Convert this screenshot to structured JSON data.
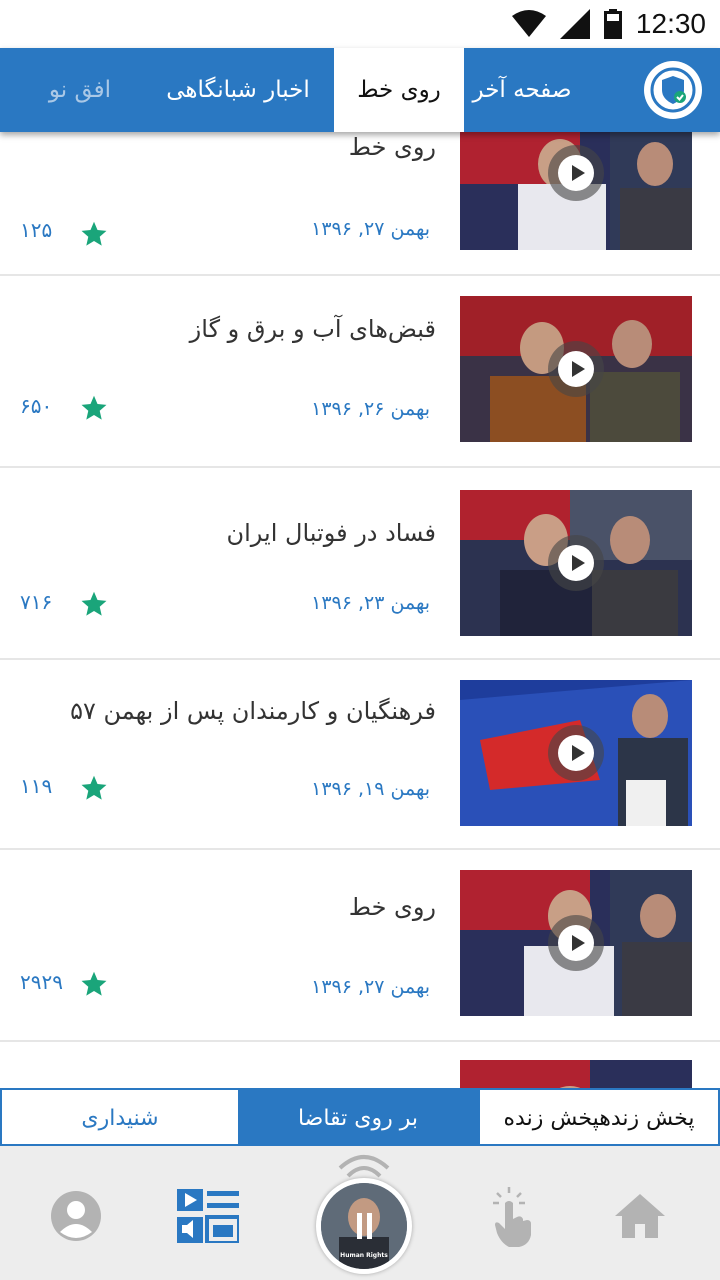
{
  "status_bar": {
    "time": "12:30"
  },
  "top_tabs": {
    "last_page": "صفحه آخر",
    "on_line": "روی خط",
    "network_news": "اخبار شبانگاهی",
    "new_horizon": "افق نو"
  },
  "videos": [
    {
      "title": "روی خط",
      "date": "بهمن ۲۷, ۱۳۹۶",
      "views": "۱۲۵"
    },
    {
      "title": "قبض‌های آب و برق و گاز",
      "date": "بهمن ۲۶, ۱۳۹۶",
      "views": "۶۵۰"
    },
    {
      "title": "فساد در فوتبال ایران",
      "date": "بهمن ۲۳, ۱۳۹۶",
      "views": "۷۱۶"
    },
    {
      "title": "فرهنگیان و کارمندان پس از بهمن ۵۷",
      "date": "بهمن ۱۹, ۱۳۹۶",
      "views": "۱۱۹"
    },
    {
      "title": "روی خط",
      "date": "بهمن ۲۷, ۱۳۹۶",
      "views": "۲۹۲۹"
    }
  ],
  "segment_tabs": {
    "live": "پخش زندهپخش زنده",
    "on_demand": "بر روی تقاضا",
    "listening": "شنیداری"
  },
  "bottom_nav": {
    "live_caption": "Human Rights"
  },
  "colors": {
    "primary": "#2a78c2",
    "star": "#1aa57a",
    "nav_bg": "#ededed"
  }
}
